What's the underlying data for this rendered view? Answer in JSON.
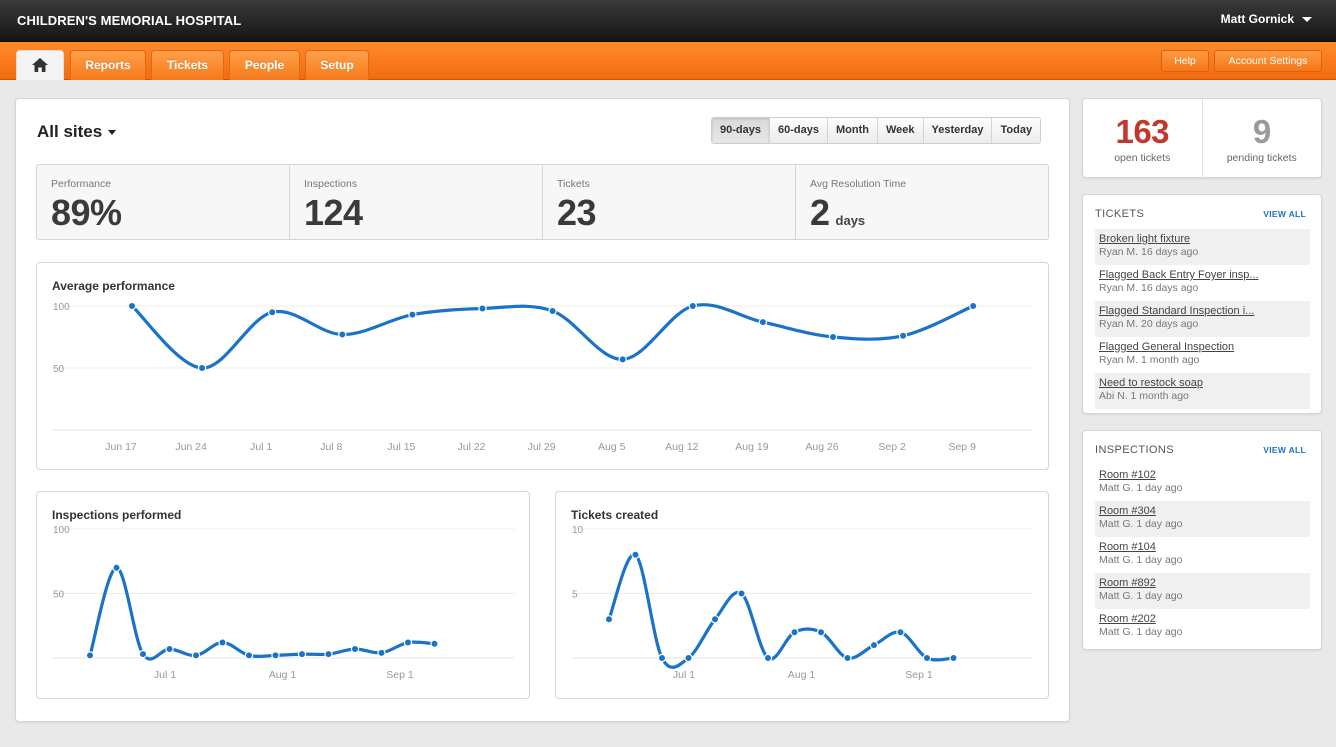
{
  "header": {
    "brand": "CHILDREN'S MEMORIAL HOSPITAL",
    "user": "Matt Gornick"
  },
  "nav": {
    "home_icon": "home-icon",
    "tabs": [
      "Reports",
      "Tickets",
      "People",
      "Setup"
    ],
    "help": "Help",
    "account": "Account Settings"
  },
  "main": {
    "site": "All sites",
    "ranges": [
      "90-days",
      "60-days",
      "Month",
      "Week",
      "Yesterday",
      "Today"
    ],
    "active_range": "90-days",
    "stats": [
      {
        "label": "Performance",
        "value": "89%",
        "unit": ""
      },
      {
        "label": "Inspections",
        "value": "124",
        "unit": ""
      },
      {
        "label": "Tickets",
        "value": "23",
        "unit": ""
      },
      {
        "label": "Avg Resolution Time",
        "value": "2",
        "unit": "days"
      }
    ]
  },
  "chart_data": [
    {
      "type": "line",
      "title": "Average performance",
      "x": [
        "Jun 17",
        "Jun 24",
        "Jul 1",
        "Jul 8",
        "Jul 15",
        "Jul 22",
        "Jul 29",
        "Aug 5",
        "Aug 12",
        "Aug 19",
        "Aug 26",
        "Sep 2",
        "Sep 9"
      ],
      "ticks": [
        "Jun 17",
        "Jun 24",
        "Jul 1",
        "Jul 8",
        "Jul 15",
        "Jul 22",
        "Jul 29",
        "Aug 5",
        "Aug 12",
        "Aug 19",
        "Aug 26",
        "Sep 2",
        "Sep 9"
      ],
      "series": [
        {
          "values": [
            100,
            50,
            95,
            77,
            93,
            98,
            96,
            57,
            100,
            87,
            75,
            76,
            100
          ]
        }
      ],
      "yticks": [
        50,
        100
      ],
      "ylim": [
        0,
        100
      ],
      "grid": true
    },
    {
      "type": "line",
      "title": "Inspections performed",
      "ticks": [
        "Jul 1",
        "Aug 1",
        "Sep 1"
      ],
      "series": [
        {
          "values": [
            2,
            70,
            3,
            7,
            2,
            12,
            2,
            2,
            3,
            3,
            7,
            4,
            12,
            11
          ]
        }
      ],
      "yticks": [
        50,
        100
      ],
      "ylim": [
        0,
        100
      ],
      "grid": true
    },
    {
      "type": "line",
      "title": "Tickets created",
      "ticks": [
        "Jul 1",
        "Aug 1",
        "Sep 1"
      ],
      "series": [
        {
          "values": [
            3,
            8,
            0,
            0,
            3,
            5,
            0,
            2,
            2,
            0,
            1,
            2,
            0,
            0
          ]
        }
      ],
      "yticks": [
        5,
        10
      ],
      "ylim": [
        0,
        10
      ],
      "grid": true
    }
  ],
  "sidebar": {
    "counts": [
      {
        "value": "163",
        "label": "open tickets",
        "color": "#c0392b"
      },
      {
        "value": "9",
        "label": "pending tickets",
        "color": "#9a9a9a"
      }
    ],
    "tickets": {
      "heading": "TICKETS",
      "view_all": "VIEW ALL",
      "items": [
        {
          "title": "Broken light fixture",
          "meta": "Ryan M.  16 days ago"
        },
        {
          "title": "Flagged Back Entry Foyer insp...",
          "meta": "Ryan M.  16 days ago"
        },
        {
          "title": "Flagged Standard Inspection i...",
          "meta": "Ryan M.  20 days ago"
        },
        {
          "title": "Flagged General Inspection",
          "meta": "Ryan M.  1 month ago"
        },
        {
          "title": "Need to restock soap",
          "meta": "Abi N.  1 month ago"
        }
      ]
    },
    "inspections": {
      "heading": "INSPECTIONS",
      "view_all": "VIEW ALL",
      "items": [
        {
          "title": "Room #102",
          "meta": "Matt G.  1 day ago"
        },
        {
          "title": "Room #304",
          "meta": "Matt G.  1 day ago"
        },
        {
          "title": "Room #104",
          "meta": "Matt G.  1 day ago"
        },
        {
          "title": "Room #892",
          "meta": "Matt G.  1 day ago"
        },
        {
          "title": "Room #202",
          "meta": "Matt G.  1 day ago"
        }
      ]
    }
  },
  "colors": {
    "accent": "#f57a1c",
    "line": "#1a73c8"
  }
}
